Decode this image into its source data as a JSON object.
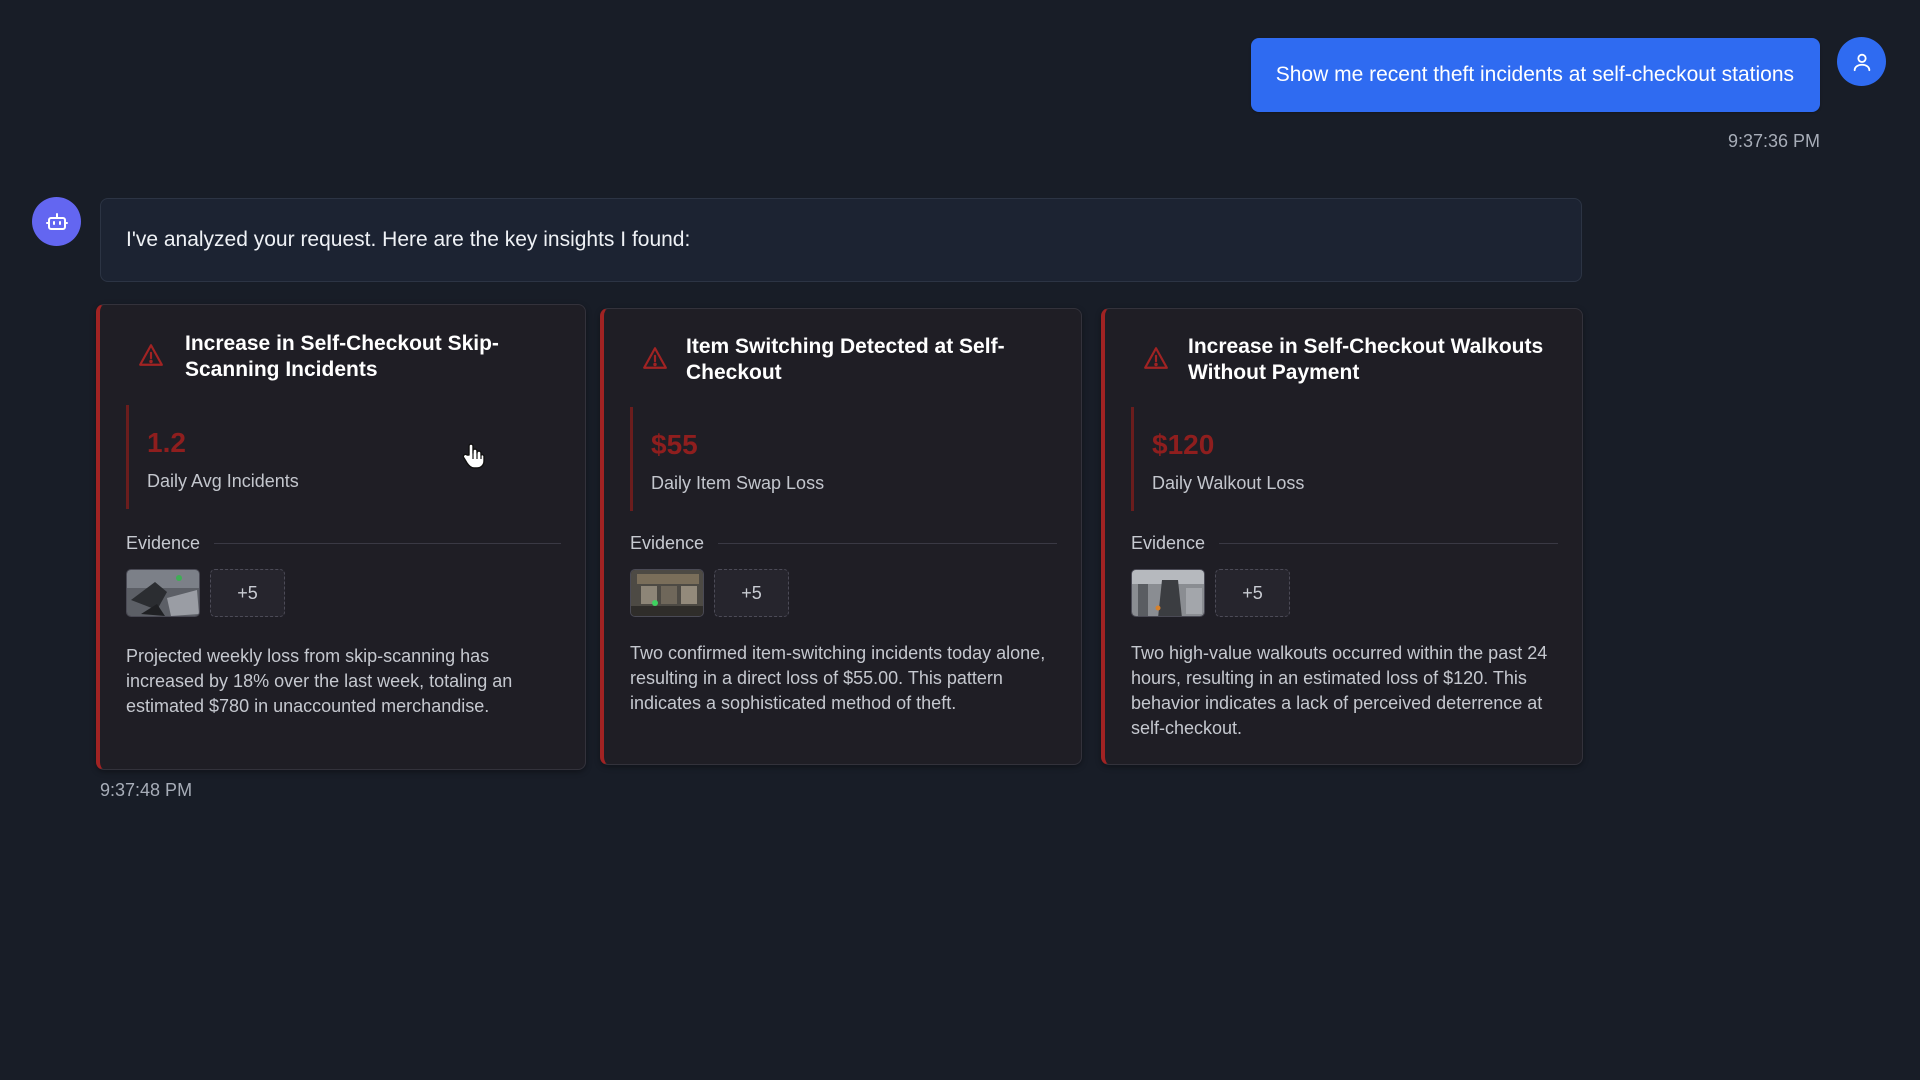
{
  "user_message": {
    "text": "Show me recent theft incidents at self-checkout stations",
    "timestamp": "9:37:36 PM",
    "avatar_icon": "user-icon"
  },
  "bot_message": {
    "text": "I've analyzed your request. Here are the key insights I found:",
    "timestamp": "9:37:48 PM",
    "avatar_icon": "robot-icon"
  },
  "cards": [
    {
      "title": "Increase in Self-Checkout Skip-Scanning Incidents",
      "metric_value": "1.2",
      "metric_label": "Daily Avg Incidents",
      "evidence_label": "Evidence",
      "more_label": "+5",
      "description": "Projected weekly loss from skip-scanning has increased by 18% over the last week, totaling an estimated $780 in unaccounted merchandise."
    },
    {
      "title": "Item Switching Detected at Self-Checkout",
      "metric_value": "$55",
      "metric_label": "Daily Item Swap Loss",
      "evidence_label": "Evidence",
      "more_label": "+5",
      "description": "Two confirmed item-switching incidents today alone, resulting in a direct loss of $55.00. This pattern indicates a sophisticated method of theft."
    },
    {
      "title": "Increase in Self-Checkout Walkouts Without Payment",
      "metric_value": "$120",
      "metric_label": "Daily Walkout Loss",
      "evidence_label": "Evidence",
      "more_label": "+5",
      "description": "Two high-value walkouts occurred within the past 24 hours, resulting in an estimated loss of $120. This behavior indicates a lack of perceived deterrence at self-checkout."
    }
  ],
  "colors": {
    "background": "#181d27",
    "user_bubble": "#2f6bf1",
    "bot_avatar": "#6366f1",
    "alert_red": "#a12323",
    "metric_red": "#8f1e1e"
  }
}
